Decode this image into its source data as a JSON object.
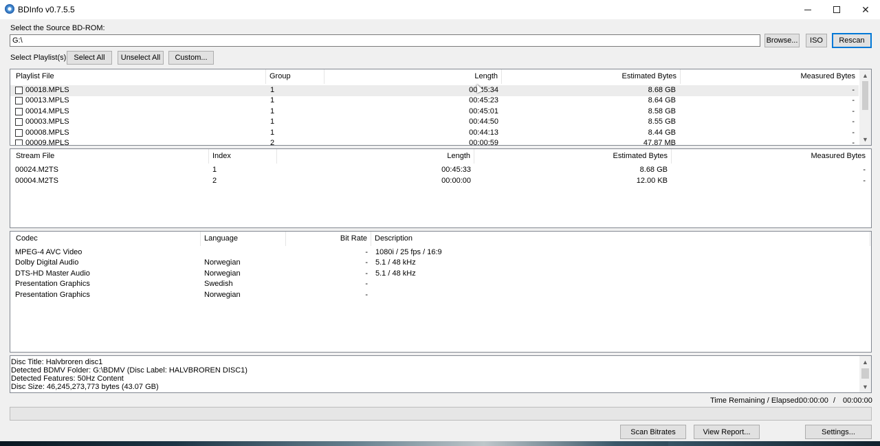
{
  "window": {
    "title": "BDInfo v0.7.5.5",
    "controls": {
      "minimize": "minimize-icon",
      "maximize": "maximize-icon",
      "close": "close-icon"
    }
  },
  "source": {
    "label": "Select the Source BD-ROM:",
    "path_value": "G:\\",
    "browse_label": "Browse...",
    "iso_label": "ISO",
    "rescan_label": "Rescan"
  },
  "playlist_select": {
    "label": "Select Playlist(s):",
    "select_all_label": "Select All",
    "unselect_all_label": "Unselect All",
    "custom_label": "Custom..."
  },
  "playlists": {
    "headers": {
      "file": "Playlist File",
      "group": "Group",
      "length": "Length",
      "estimated": "Estimated Bytes",
      "measured": "Measured Bytes"
    },
    "rows": [
      {
        "file": "00018.MPLS",
        "group": "1",
        "length": "00:45:34",
        "estimated": "8.68 GB",
        "measured": "-"
      },
      {
        "file": "00013.MPLS",
        "group": "1",
        "length": "00:45:23",
        "estimated": "8.64 GB",
        "measured": "-"
      },
      {
        "file": "00014.MPLS",
        "group": "1",
        "length": "00:45:01",
        "estimated": "8.58 GB",
        "measured": "-"
      },
      {
        "file": "00003.MPLS",
        "group": "1",
        "length": "00:44:50",
        "estimated": "8.55 GB",
        "measured": "-"
      },
      {
        "file": "00008.MPLS",
        "group": "1",
        "length": "00:44:13",
        "estimated": "8.44 GB",
        "measured": "-"
      },
      {
        "file": "00009.MPLS",
        "group": "2",
        "length": "00:00:59",
        "estimated": "47.87 MB",
        "measured": "-"
      }
    ]
  },
  "streams": {
    "headers": {
      "file": "Stream File",
      "index": "Index",
      "length": "Length",
      "estimated": "Estimated Bytes",
      "measured": "Measured Bytes"
    },
    "rows": [
      {
        "file": "00024.M2TS",
        "index": "1",
        "length": "00:45:33",
        "estimated": "8.68 GB",
        "measured": "-"
      },
      {
        "file": "00004.M2TS",
        "index": "2",
        "length": "00:00:00",
        "estimated": "12.00 KB",
        "measured": "-"
      }
    ]
  },
  "codecs": {
    "headers": {
      "codec": "Codec",
      "language": "Language",
      "bitrate": "Bit Rate",
      "description": "Description"
    },
    "rows": [
      {
        "codec": "MPEG-4 AVC Video",
        "language": "",
        "bitrate": "-",
        "description": "1080i / 25 fps / 16:9"
      },
      {
        "codec": "Dolby Digital Audio",
        "language": "Norwegian",
        "bitrate": "-",
        "description": "5.1 / 48 kHz"
      },
      {
        "codec": "DTS-HD Master Audio",
        "language": "Norwegian",
        "bitrate": "-",
        "description": "5.1 / 48 kHz"
      },
      {
        "codec": "Presentation Graphics",
        "language": "Swedish",
        "bitrate": "-",
        "description": ""
      },
      {
        "codec": "Presentation Graphics",
        "language": "Norwegian",
        "bitrate": "-",
        "description": ""
      }
    ]
  },
  "info_lines": [
    "Disc Title: Halvbroren disc1",
    "Detected BDMV Folder: G:\\BDMV (Disc Label: HALVBROREN DISC1)",
    "Detected Features: 50Hz Content",
    "Disc Size: 46,245,273,773 bytes (43.07 GB)"
  ],
  "status": {
    "time_label": "Time Remaining / Elapsed:",
    "remaining": "00:00:00",
    "separator": "/",
    "elapsed": "00:00:00"
  },
  "bottom_buttons": {
    "scan_bitrates": "Scan Bitrates",
    "view_report": "View Report...",
    "settings": "Settings..."
  }
}
